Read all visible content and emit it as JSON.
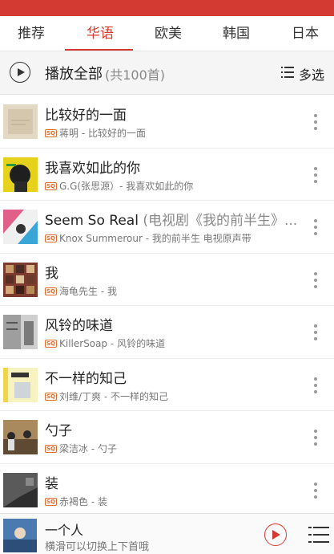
{
  "tabs": [
    {
      "label": "推荐",
      "active": false
    },
    {
      "label": "华语",
      "active": true
    },
    {
      "label": "欧美",
      "active": false
    },
    {
      "label": "韩国",
      "active": false
    },
    {
      "label": "日本",
      "active": false
    }
  ],
  "play_all": {
    "label": "播放全部",
    "count": "(共100首)",
    "multi_select": "多选"
  },
  "songs": [
    {
      "title": "比较好的一面",
      "title_extra": "",
      "quality": "SQ",
      "subtitle": "蒋明 - 比较好的一面",
      "cover_color": "#d8cdb8"
    },
    {
      "title": "我喜欢如此的你",
      "title_extra": "",
      "quality": "SQ",
      "subtitle": "G.G(张思源）- 我喜欢如此的你",
      "cover_color": "#e7d21b"
    },
    {
      "title": "Seem So Real",
      "title_extra": " (电视剧《我的前半生》...",
      "quality": "SQ",
      "subtitle": "Knox Summerour - 我的前半生 电视原声带",
      "cover_color": "#e0608a"
    },
    {
      "title": "我",
      "title_extra": "",
      "quality": "SQ",
      "subtitle": "海龟先生 - 我",
      "cover_color": "#8a4a3a"
    },
    {
      "title": "风铃的味道",
      "title_extra": "",
      "quality": "SQ",
      "subtitle": "KillerSoap - 风铃的味道",
      "cover_color": "#9a9a9a"
    },
    {
      "title": "不一样的知己",
      "title_extra": "",
      "quality": "SQ",
      "subtitle": "刘维/丁爽 - 不一样的知己",
      "cover_color": "#f2ee9a"
    },
    {
      "title": "勺子",
      "title_extra": "",
      "quality": "SQ",
      "subtitle": "梁洁冰 - 勺子",
      "cover_color": "#8b6a4a"
    },
    {
      "title": "装",
      "title_extra": "",
      "quality": "SQ",
      "subtitle": "赤褐色 - 装",
      "cover_color": "#6a6a6a"
    }
  ],
  "player": {
    "title": "一个人",
    "subtitle": "横滑可以切换上下首哦"
  },
  "colors": {
    "accent": "#d33a31",
    "quality_badge": "#e06c2e"
  }
}
